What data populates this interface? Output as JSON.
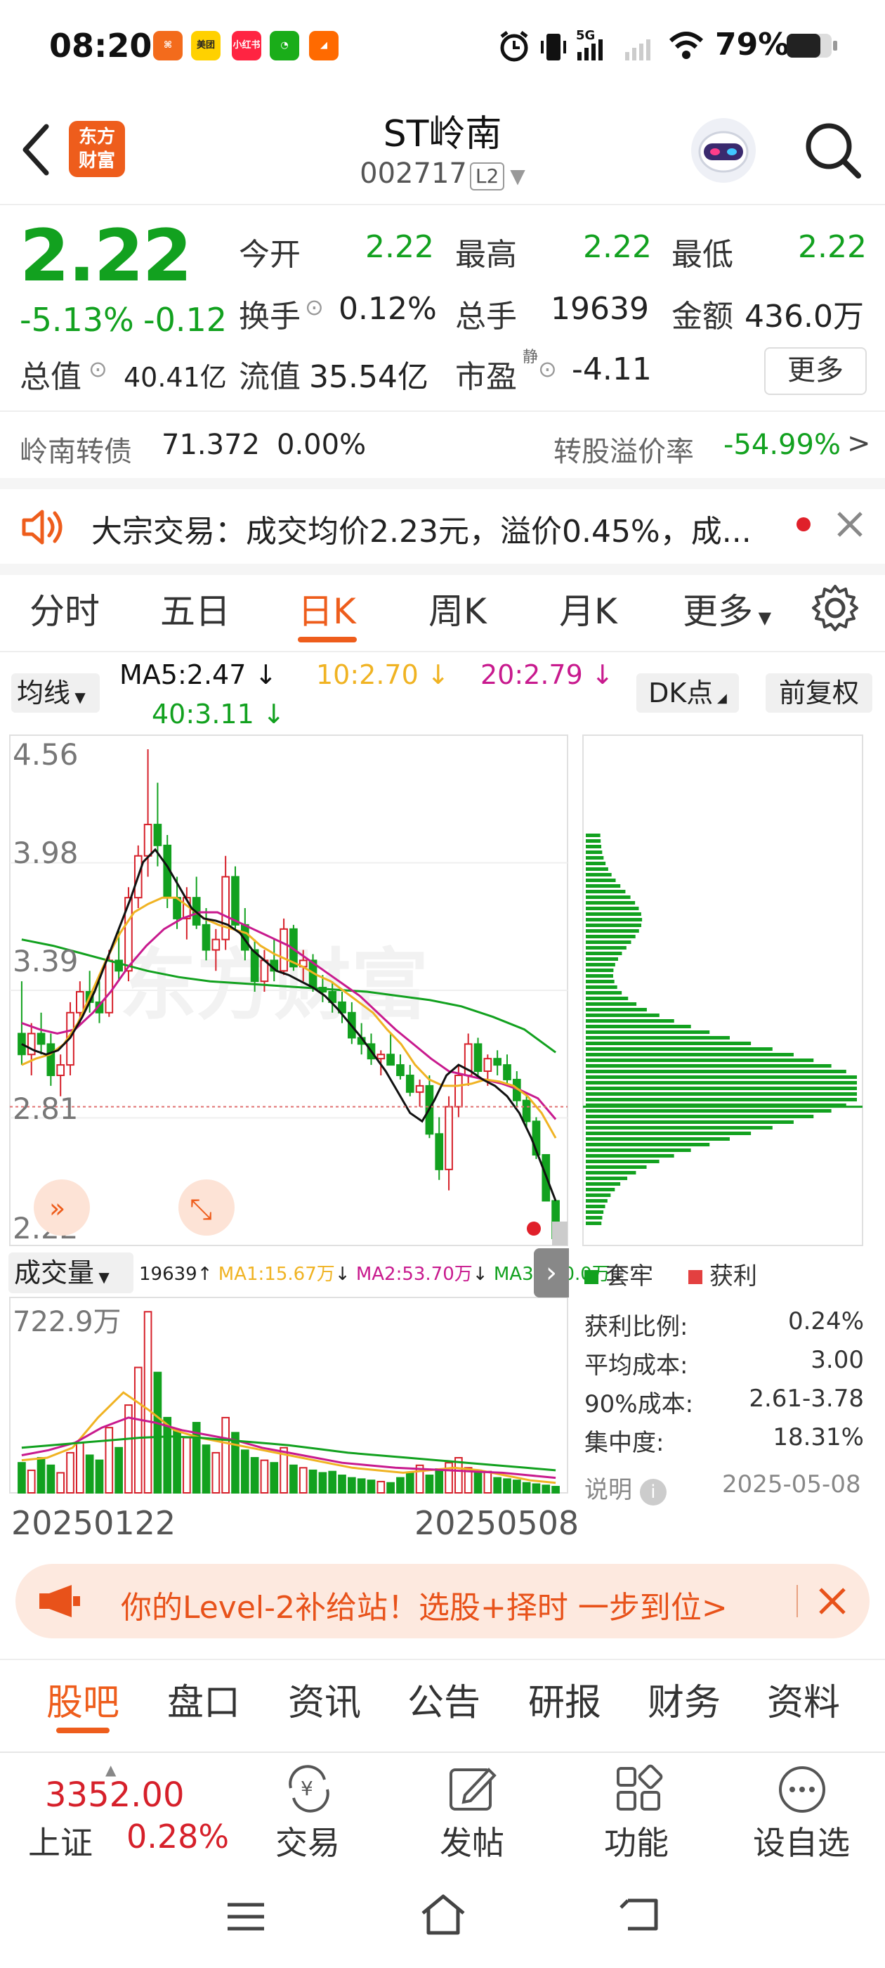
{
  "status_bar": {
    "time": "08:20",
    "battery_percent": "79%",
    "network": "5G",
    "apps": [
      {
        "name": "app1",
        "color": "#f36b1c",
        "label": "⌘"
      },
      {
        "name": "meituan",
        "color": "#ffd100",
        "label": "美团"
      },
      {
        "name": "xiaohongshu",
        "color": "#ff2442",
        "label": "小红书"
      },
      {
        "name": "wechat",
        "color": "#1aad19",
        "label": "◔"
      },
      {
        "name": "app5",
        "color": "#ff6a00",
        "label": "◢"
      }
    ]
  },
  "header": {
    "logo_line1": "东方",
    "logo_line2": "财富",
    "stock_name": "ST岭南",
    "stock_code": "002717",
    "level": "L2"
  },
  "quote": {
    "price": "2.22",
    "change_pct": "-5.13%",
    "change": "-0.12",
    "open_label": "今开",
    "open": "2.22",
    "high_label": "最高",
    "high": "2.22",
    "low_label": "最低",
    "low": "2.22",
    "turnover_label": "换手",
    "turnover": "0.12%",
    "volume_label": "总手",
    "volume": "19639",
    "amount_label": "金额",
    "amount": "436.0万",
    "mktcap_label": "总值",
    "mktcap": "40.41亿",
    "float_label": "流值",
    "float": "35.54亿",
    "pe_label": "市盈",
    "pe_sup": "静",
    "pe": "-4.11",
    "more_label": "更多"
  },
  "bond": {
    "name": "岭南转债",
    "price": "71.372",
    "change": "0.00%",
    "premium_label": "转股溢价率",
    "premium": "-54.99%"
  },
  "notice": {
    "text": "大宗交易：成交均价2.23元，溢价0.45%，成..."
  },
  "chart_tabs": [
    "分时",
    "五日",
    "日K",
    "周K",
    "月K",
    "更多"
  ],
  "active_tab": "日K",
  "ma": {
    "selector": "均线",
    "ma5": "MA5:2.47",
    "ma10": "10:2.70",
    "ma20": "20:2.79",
    "ma40": "40:3.11",
    "dk_label": "DK点",
    "adjust_label": "前复权"
  },
  "price_axis": [
    "4.56",
    "3.98",
    "3.39",
    "2.81",
    "2.22"
  ],
  "volume_bar": {
    "selector": "成交量",
    "vol": "19639",
    "ma1": "MA1:15.67万",
    "ma2": "MA2:53.70万",
    "ma3": "MA3:100.0万",
    "max_label": "722.9万"
  },
  "date_range": {
    "start": "20250122",
    "end": "20250508"
  },
  "chip": {
    "legend_trapped": "套牢",
    "legend_profit": "获利",
    "rows": [
      {
        "label": "获利比例:",
        "value": "0.24%"
      },
      {
        "label": "平均成本:",
        "value": "3.00"
      },
      {
        "label": "90%成本:",
        "value": "2.61-3.78"
      },
      {
        "label": "集中度:",
        "value": "18.31%"
      }
    ],
    "note_label": "说明",
    "date": "2025-05-08"
  },
  "colors": {
    "up": "#d6202a",
    "down": "#12a11f",
    "accent": "#ee5d1c",
    "ma5": "#111111",
    "ma10": "#f0b323",
    "ma20": "#c81a8e",
    "ma40": "#12a11f"
  },
  "chart_data": {
    "type": "candlestick",
    "x_start": "20250122",
    "x_end": "20250508",
    "ylim": [
      2.22,
      4.56
    ],
    "candles": [
      [
        3.2,
        3.45,
        3.05,
        3.1
      ],
      [
        3.1,
        3.25,
        3.0,
        3.2
      ],
      [
        3.2,
        3.3,
        3.1,
        3.15
      ],
      [
        3.15,
        3.2,
        2.95,
        3.0
      ],
      [
        3.0,
        3.1,
        2.9,
        3.05
      ],
      [
        3.05,
        3.35,
        3.0,
        3.3
      ],
      [
        3.3,
        3.45,
        3.25,
        3.4
      ],
      [
        3.4,
        3.5,
        3.3,
        3.35
      ],
      [
        3.35,
        3.45,
        3.25,
        3.3
      ],
      [
        3.3,
        3.6,
        3.28,
        3.55
      ],
      [
        3.55,
        3.7,
        3.45,
        3.5
      ],
      [
        3.5,
        3.9,
        3.45,
        3.85
      ],
      [
        3.85,
        4.1,
        3.8,
        4.05
      ],
      [
        4.05,
        4.56,
        3.95,
        4.2
      ],
      [
        4.2,
        4.4,
        4.0,
        4.1
      ],
      [
        4.1,
        4.15,
        3.8,
        3.85
      ],
      [
        3.85,
        3.95,
        3.7,
        3.75
      ],
      [
        3.75,
        3.9,
        3.65,
        3.85
      ],
      [
        3.85,
        3.95,
        3.7,
        3.72
      ],
      [
        3.72,
        3.8,
        3.55,
        3.6
      ],
      [
        3.6,
        3.7,
        3.5,
        3.65
      ],
      [
        3.65,
        4.05,
        3.6,
        3.95
      ],
      [
        3.95,
        4.0,
        3.7,
        3.72
      ],
      [
        3.72,
        3.8,
        3.55,
        3.6
      ],
      [
        3.6,
        3.65,
        3.4,
        3.45
      ],
      [
        3.45,
        3.6,
        3.4,
        3.55
      ],
      [
        3.55,
        3.65,
        3.45,
        3.5
      ],
      [
        3.5,
        3.75,
        3.48,
        3.7
      ],
      [
        3.7,
        3.72,
        3.5,
        3.52
      ],
      [
        3.52,
        3.6,
        3.45,
        3.55
      ],
      [
        3.55,
        3.58,
        3.4,
        3.42
      ],
      [
        3.42,
        3.48,
        3.35,
        3.4
      ],
      [
        3.4,
        3.45,
        3.3,
        3.35
      ],
      [
        3.35,
        3.4,
        3.25,
        3.3
      ],
      [
        3.3,
        3.35,
        3.15,
        3.18
      ],
      [
        3.18,
        3.25,
        3.1,
        3.15
      ],
      [
        3.15,
        3.2,
        3.05,
        3.08
      ],
      [
        3.08,
        3.12,
        3.0,
        3.1
      ],
      [
        3.1,
        3.2,
        3.05,
        3.05
      ],
      [
        3.05,
        3.1,
        2.98,
        3.0
      ],
      [
        3.0,
        3.05,
        2.9,
        2.92
      ],
      [
        2.92,
        2.98,
        2.85,
        2.95
      ],
      [
        2.95,
        3.0,
        2.7,
        2.72
      ],
      [
        2.72,
        2.8,
        2.5,
        2.55
      ],
      [
        2.55,
        2.9,
        2.45,
        2.85
      ],
      [
        2.85,
        3.05,
        2.8,
        3.0
      ],
      [
        3.0,
        3.2,
        2.95,
        3.15
      ],
      [
        3.15,
        3.18,
        3.0,
        3.02
      ],
      [
        3.02,
        3.1,
        2.95,
        3.08
      ],
      [
        3.08,
        3.12,
        3.0,
        3.05
      ],
      [
        3.05,
        3.1,
        2.95,
        2.98
      ],
      [
        2.98,
        3.02,
        2.85,
        2.88
      ],
      [
        2.88,
        2.92,
        2.75,
        2.78
      ],
      [
        2.78,
        2.8,
        2.6,
        2.62
      ],
      [
        2.62,
        2.62,
        2.4,
        2.4
      ],
      [
        2.4,
        2.4,
        2.22,
        2.22
      ]
    ],
    "ma5": [
      3.15,
      3.12,
      3.1,
      3.12,
      3.18,
      3.28,
      3.4,
      3.55,
      3.7,
      3.85,
      4.02,
      4.08,
      4.0,
      3.9,
      3.8,
      3.75,
      3.74,
      3.72,
      3.68,
      3.6,
      3.55,
      3.5,
      3.48,
      3.45,
      3.42,
      3.38,
      3.32,
      3.25,
      3.18,
      3.1,
      3.02,
      2.92,
      2.82,
      2.78,
      2.88,
      3.0,
      3.05,
      3.02,
      2.98,
      2.95,
      2.9,
      2.82,
      2.7,
      2.55,
      2.4
    ],
    "ma10": [
      3.05,
      3.08,
      3.1,
      3.15,
      3.25,
      3.4,
      3.55,
      3.68,
      3.78,
      3.82,
      3.85,
      3.85,
      3.8,
      3.75,
      3.72,
      3.7,
      3.68,
      3.62,
      3.58,
      3.55,
      3.52,
      3.48,
      3.45,
      3.4,
      3.35,
      3.3,
      3.22,
      3.15,
      3.05,
      2.98,
      2.95,
      2.95,
      2.96,
      2.98,
      2.97,
      2.95,
      2.9,
      2.82,
      2.7
    ],
    "ma20": [
      3.25,
      3.22,
      3.2,
      3.22,
      3.3,
      3.4,
      3.52,
      3.62,
      3.7,
      3.75,
      3.78,
      3.78,
      3.74,
      3.7,
      3.66,
      3.62,
      3.56,
      3.5,
      3.44,
      3.38,
      3.3,
      3.22,
      3.15,
      3.08,
      3.02,
      3.0,
      2.98,
      2.96,
      2.93,
      2.89,
      2.79
    ],
    "ma40": [
      3.65,
      3.62,
      3.58,
      3.54,
      3.5,
      3.47,
      3.45,
      3.44,
      3.43,
      3.42,
      3.41,
      3.4,
      3.38,
      3.36,
      3.33,
      3.28,
      3.22,
      3.11
    ],
    "volume_ylim": [
      0,
      722.9
    ]
  }
}
